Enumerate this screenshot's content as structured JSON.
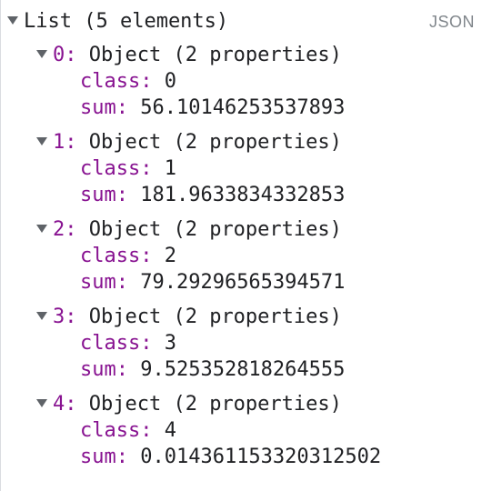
{
  "root": {
    "label": "List (5 elements)"
  },
  "json_button": "JSON",
  "items": [
    {
      "index": "0:",
      "summary": " Object (2 properties)",
      "class_key": "class:",
      "class_value": " 0",
      "sum_key": "sum:",
      "sum_value": " 56.10146253537893"
    },
    {
      "index": "1:",
      "summary": " Object (2 properties)",
      "class_key": "class:",
      "class_value": " 1",
      "sum_key": "sum:",
      "sum_value": " 181.9633834332853"
    },
    {
      "index": "2:",
      "summary": " Object (2 properties)",
      "class_key": "class:",
      "class_value": " 2",
      "sum_key": "sum:",
      "sum_value": " 79.29296565394571"
    },
    {
      "index": "3:",
      "summary": " Object (2 properties)",
      "class_key": "class:",
      "class_value": " 3",
      "sum_key": "sum:",
      "sum_value": " 9.525352818264555"
    },
    {
      "index": "4:",
      "summary": " Object (2 properties)",
      "class_key": "class:",
      "class_value": " 4",
      "sum_key": "sum:",
      "sum_value": " 0.014361153320312502"
    }
  ]
}
